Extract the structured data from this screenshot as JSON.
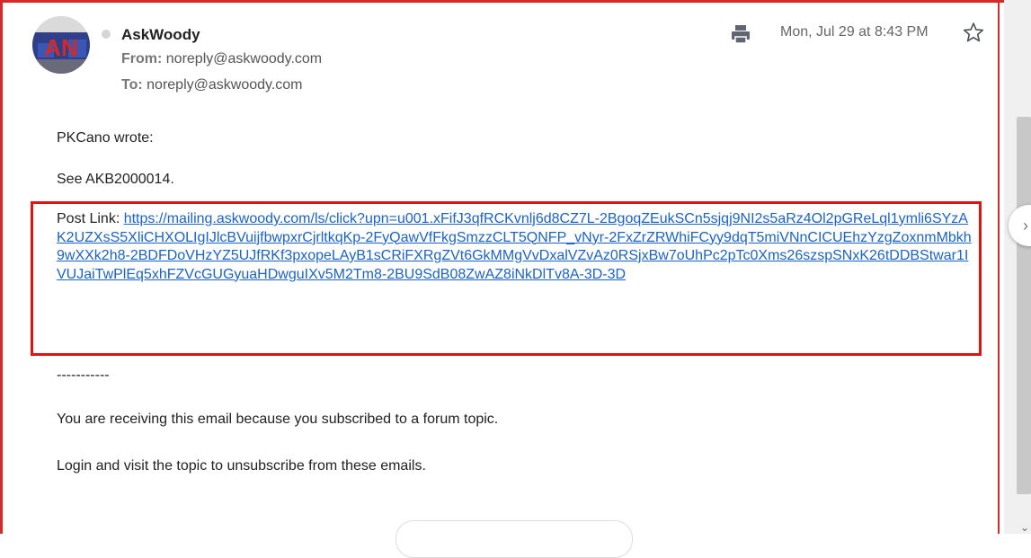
{
  "header": {
    "sender_name": "AskWoody",
    "from_label": "From:",
    "from_address": "noreply@askwoody.com",
    "to_label": "To:",
    "to_address": "noreply@askwoody.com",
    "date": "Mon, Jul 29 at 8:43 PM",
    "avatar_text": "AN"
  },
  "body": {
    "greeting": "PKCano wrote:",
    "see_line": "See AKB2000014.",
    "post_link_label": "Post Link: ",
    "post_link_url": "https://mailing.askwoody.com/ls/click?upn=u001.xFifJ3qfRCKvnlj6d8CZ7L-2BgoqZEukSCn5sjqj9NI2s5aRz4Ol2pGReLql1ymli6SYzAK2UZXsS5XliCHXOLIgIJlcBVuijfbwpxrCjrltkqKp-2FyQawVfFkgSmzzCLT5QNFP_vNyr-2FxZrZRWhiFCyy9dqT5miVNnCICUEhzYzgZoxnmMbkh9wXXk2h8-2BDFDoVHzYZ5UJfRKf3pxopeLAyB1sCRiFXRgZVt6GkMMgVvDxalVZvAz0RSjxBw7oUhPc2pTc0Xms26szspSNxK26tDDBStwar1IVUJaiTwPlEq5xhFZVcGUGyuaHDwguIXv5M2Tm8-2BU9SdB08ZwAZ8iNkDlTv8A-3D-3D",
    "separator": "-----------",
    "notice_1": "You are receiving this email because you subscribed to a forum topic.",
    "notice_2": "Login and visit the topic to unsubscribe from these emails."
  },
  "colors": {
    "highlight_border": "#e01212",
    "link": "#1a63c9",
    "frame": "#d42a2a"
  },
  "icons": {
    "print": "print-icon",
    "star": "star-icon",
    "next": "chevron-right-icon",
    "scroll_down": "chevron-down-icon"
  }
}
